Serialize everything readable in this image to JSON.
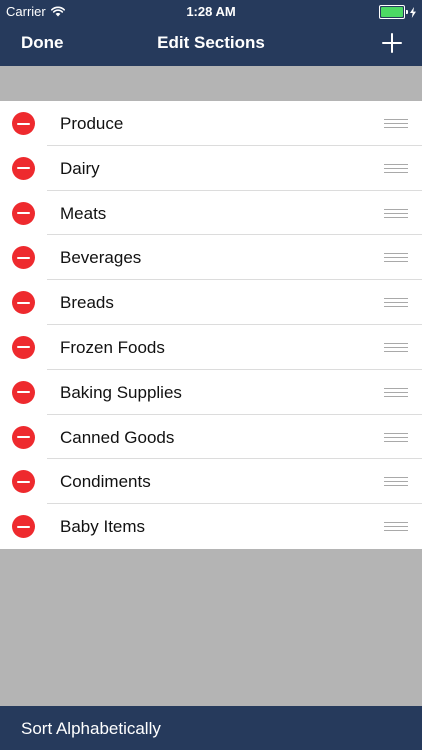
{
  "status_bar": {
    "carrier": "Carrier",
    "time": "1:28 AM",
    "wifi_icon": "wifi-icon",
    "battery_icon": "battery-icon",
    "battery_level": 1.0,
    "charging_icon": "lightning-bolt-icon"
  },
  "nav": {
    "done_label": "Done",
    "title": "Edit Sections",
    "add_icon": "plus-icon"
  },
  "sections": [
    {
      "name": "Produce"
    },
    {
      "name": "Dairy"
    },
    {
      "name": "Meats"
    },
    {
      "name": "Beverages"
    },
    {
      "name": "Breads"
    },
    {
      "name": "Frozen Foods"
    },
    {
      "name": "Baking Supplies"
    },
    {
      "name": "Canned Goods"
    },
    {
      "name": "Condiments"
    },
    {
      "name": "Baby Items"
    }
  ],
  "row_icons": {
    "delete": "delete-minus-icon",
    "reorder": "reorder-handle-icon"
  },
  "footer": {
    "sort_label": "Sort Alphabetically"
  },
  "colors": {
    "bar_background": "#263a5c",
    "delete_red": "#ee2a2e",
    "empty_background": "#b4b4b4",
    "battery_green": "#4cd964"
  }
}
